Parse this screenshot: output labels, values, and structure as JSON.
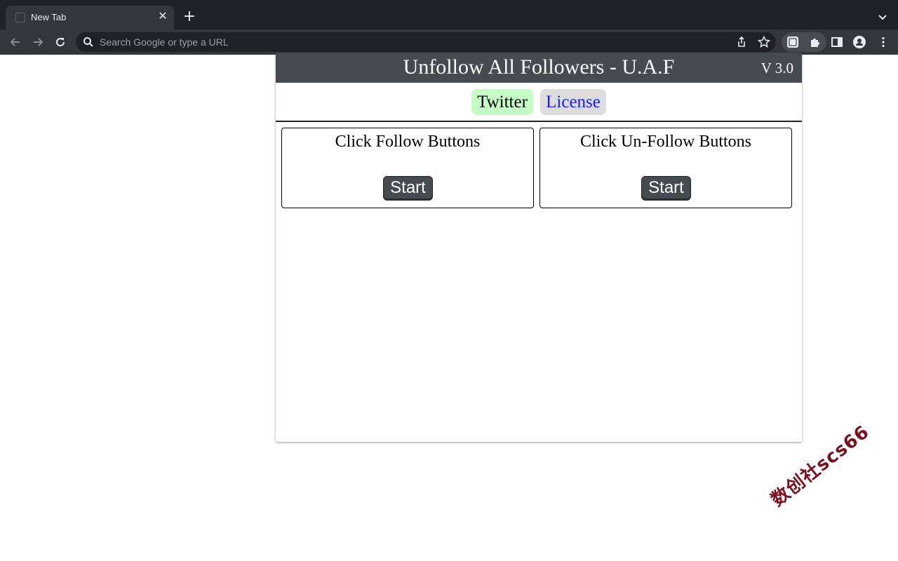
{
  "browser": {
    "tab_title": "New Tab",
    "tab_close": "✕",
    "new_tab": "+",
    "omnibox_placeholder": "Search Google or type a URL"
  },
  "popup": {
    "title": "Unfollow All Followers - U.A.F",
    "version": "V 3.0",
    "nav": {
      "twitter": "Twitter",
      "license": "License"
    },
    "cards": [
      {
        "title": "Click Follow Buttons",
        "button": "Start"
      },
      {
        "title": "Click Un-Follow Buttons",
        "button": "Start"
      }
    ]
  },
  "watermark": "数创社scs66",
  "colors": {
    "header_bg": "#464b4f",
    "twitter_pill": "#c5fcc5",
    "license_pill": "#dcdcdc",
    "license_text": "#1a1aff"
  }
}
